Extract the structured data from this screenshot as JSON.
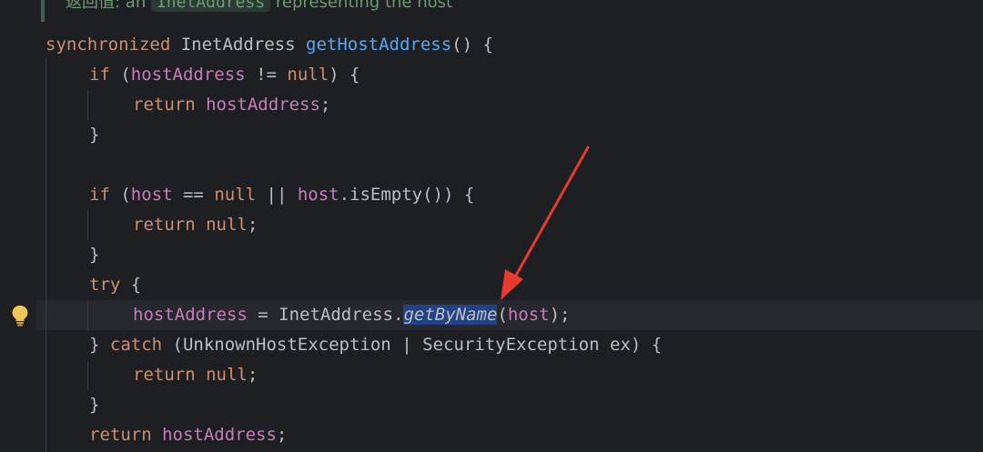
{
  "doc": {
    "prefix": "返回值: an ",
    "code": "InetAddress",
    "suffix": " representing the host"
  },
  "code": {
    "l1": {
      "kw": "synchronized ",
      "type": "InetAddress ",
      "name": "getHostAddress",
      "rest": "() {"
    },
    "l2": {
      "kw": "if ",
      "open": "(",
      "field": "hostAddress",
      "op": " != ",
      "nul": "null",
      "close": ") {"
    },
    "l3": {
      "kw": "return ",
      "field": "hostAddress",
      "end": ";"
    },
    "l4": {
      "brace": "}"
    },
    "l6": {
      "kw": "if ",
      "open": "(",
      "f1": "host",
      "op1": " == ",
      "nul": "null",
      "op2": " || ",
      "f2": "host",
      "call": ".isEmpty()) {"
    },
    "l7": {
      "kw": "return ",
      "nul": "null",
      "end": ";"
    },
    "l8": {
      "brace": "}"
    },
    "l9": {
      "kw": "try",
      "rest": " {"
    },
    "l10": {
      "field": "hostAddress",
      "op": " = InetAddress.",
      "method": "getByName",
      "open": "(",
      "arg": "host",
      "end": ");"
    },
    "l11": {
      "brace": "} ",
      "kw": "catch",
      "rest": " (UnknownHostException | SecurityException ex) {"
    },
    "l12": {
      "kw": "return ",
      "nul": "null",
      "end": ";"
    },
    "l13": {
      "brace": "}"
    },
    "l14": {
      "kw": "return ",
      "field": "hostAddress",
      "end": ";"
    }
  },
  "colors": {
    "background": "#1e1f22",
    "keyword": "#cf8e6d",
    "field": "#c77dbb",
    "function": "#56a8f5",
    "selection": "#214283",
    "annotation_arrow": "#e83a2e"
  },
  "icons": {
    "gutter": "lightbulb-icon"
  }
}
